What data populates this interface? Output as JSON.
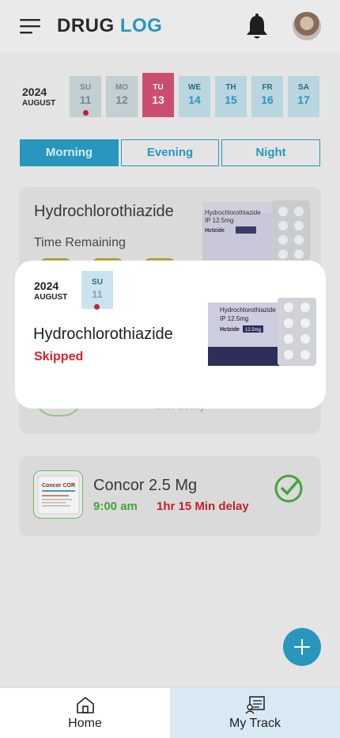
{
  "header": {
    "title_part1": "DRUG",
    "title_part2": "LOG",
    "menu_icon": "hamburger-menu-icon",
    "notification_icon": "bell-icon"
  },
  "calendar": {
    "year": "2024",
    "month": "AUGUST",
    "days": [
      {
        "name": "SU",
        "date": "11",
        "state": "past",
        "missed": true
      },
      {
        "name": "MO",
        "date": "12",
        "state": "past",
        "missed": false
      },
      {
        "name": "TU",
        "date": "13",
        "state": "today",
        "missed": false
      },
      {
        "name": "WE",
        "date": "14",
        "state": "future",
        "missed": false
      },
      {
        "name": "TH",
        "date": "15",
        "state": "future",
        "missed": false
      },
      {
        "name": "FR",
        "date": "16",
        "state": "future",
        "missed": false
      },
      {
        "name": "SA",
        "date": "17",
        "state": "future",
        "missed": false
      }
    ]
  },
  "tabs": [
    {
      "label": "Morning",
      "active": true
    },
    {
      "label": "Evening",
      "active": false
    },
    {
      "label": "Night",
      "active": false
    }
  ],
  "cards": [
    {
      "name": "Hydrochlorothiazide",
      "time_remaining_label": "Time Remaining",
      "delay": "Min delay"
    },
    {
      "name": "Concor 2.5 Mg",
      "time": "9:00 am",
      "delay": "1hr 15 Min delay",
      "logo_text": "Concor COR"
    }
  ],
  "modal": {
    "year": "2024",
    "month": "AUGUST",
    "day_name": "SU",
    "day_date": "11",
    "drug_name": "Hydrochlorothiazide",
    "status": "Skipped",
    "pack_line1": "Hydrochlorothiazide",
    "pack_line2": "IP 12.5mg",
    "pack_brand": "Hctzide",
    "pack_dose": "12.5mg"
  },
  "bottom_nav": [
    {
      "label": "Home",
      "icon": "home-icon",
      "active": false
    },
    {
      "label": "My Track",
      "icon": "track-icon",
      "active": true
    }
  ],
  "colors": {
    "accent": "#2a9bc4",
    "today": "#d45075",
    "danger": "#d4232d",
    "success": "#4aa83f"
  }
}
